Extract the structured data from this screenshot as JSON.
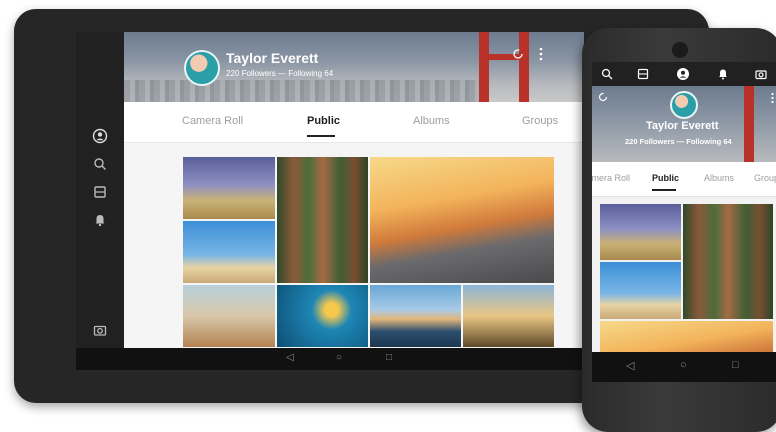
{
  "profile": {
    "name": "Taylor Everett",
    "followers_label": "220 Followers — Following 64"
  },
  "tablet": {
    "tabs": [
      {
        "label": "Camera Roll",
        "active": false
      },
      {
        "label": "Public",
        "active": true
      },
      {
        "label": "Albums",
        "active": false
      },
      {
        "label": "Groups",
        "active": false
      }
    ],
    "rail_icons": [
      "profile-icon",
      "search-icon",
      "albums-icon",
      "notifications-icon",
      "camera-icon"
    ],
    "cover_icons": [
      "refresh-icon",
      "more-icon"
    ],
    "nav_icons": [
      "back-icon",
      "home-icon",
      "recents-icon"
    ]
  },
  "phone": {
    "toolbar_icons": [
      "search-icon",
      "albums-icon",
      "profile-icon",
      "notifications-icon",
      "camera-icon"
    ],
    "tabs": [
      {
        "label": "Camera Roll",
        "active": false
      },
      {
        "label": "Public",
        "active": true
      },
      {
        "label": "Albums",
        "active": false
      },
      {
        "label": "Groups",
        "active": false
      }
    ],
    "nav_icons": [
      "back-icon",
      "home-icon",
      "recents-icon"
    ]
  },
  "colors": {
    "accent_red": "#b8322a",
    "dark_chrome": "#212121",
    "avatar_teal": "#2b9fa8"
  }
}
